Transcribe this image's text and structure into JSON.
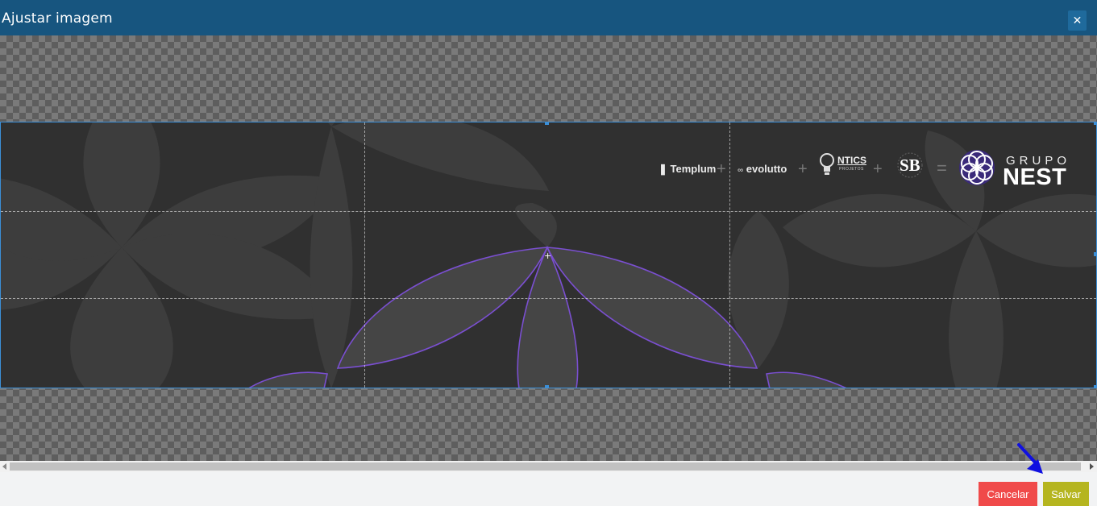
{
  "dialog": {
    "title": "Ajustar imagem",
    "close_icon": "close-icon",
    "close_glyph": "✕"
  },
  "image": {
    "logos": {
      "templum": "Templum",
      "evolutto": "evolutto",
      "ntics": "NTICS",
      "ntics_sub": "PROJETOS",
      "sb": "SB",
      "grupo": "GRUPO",
      "nest": "NEST",
      "plus": "+",
      "equals": "="
    }
  },
  "footer": {
    "cancel_label": "Cancelar",
    "save_label": "Salvar"
  },
  "colors": {
    "header": "#17557f",
    "cancel": "#f04a4a",
    "save": "#b5b51f",
    "crop_border": "#3b8fd8",
    "accent_pointer": "#1010e0"
  }
}
